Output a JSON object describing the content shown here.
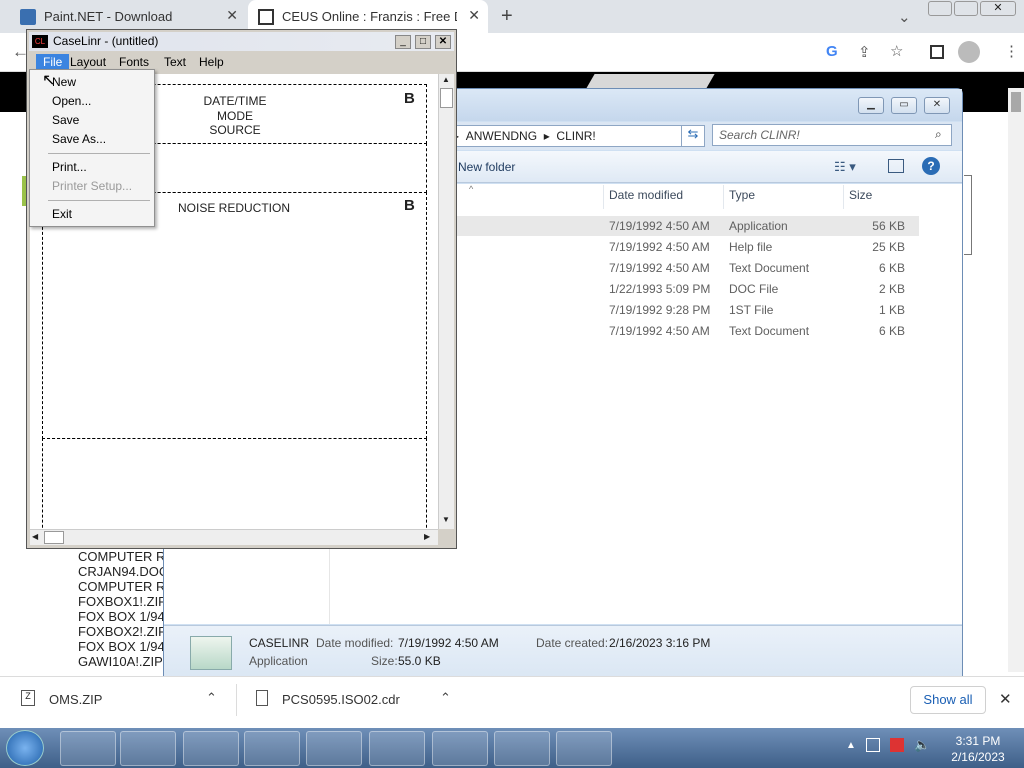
{
  "browser": {
    "tabs": [
      {
        "title": "Paint.NET - Download"
      },
      {
        "title": "CEUS Online : Franzis : Free Dow"
      }
    ],
    "new_tab": "+"
  },
  "explorer": {
    "breadcrumb": [
      "ANWENDNG",
      "CLINR!"
    ],
    "search_placeholder": "Search CLINR!",
    "toolbar_new_folder": "New folder",
    "columns": {
      "date": "Date modified",
      "type": "Type",
      "size": "Size"
    },
    "rows": [
      {
        "date": "7/19/1992 4:50 AM",
        "type": "Application",
        "size": "56 KB"
      },
      {
        "date": "7/19/1992 4:50 AM",
        "type": "Help file",
        "size": "25 KB"
      },
      {
        "date": "7/19/1992 4:50 AM",
        "type": "Text Document",
        "size": "6 KB"
      },
      {
        "date": "1/22/1993 5:09 PM",
        "type": "DOC File",
        "size": "2 KB"
      },
      {
        "date": "7/19/1992 9:28 PM",
        "type": "1ST File",
        "size": "1 KB"
      },
      {
        "date": "7/19/1992 4:50 AM",
        "type": "Text Document",
        "size": "6 KB"
      }
    ],
    "details": {
      "name": "CASELINR",
      "kind": "Application",
      "date_modified_label": "Date modified:",
      "date_modified": "7/19/1992 4:50 AM",
      "date_created_label": "Date created:",
      "date_created": "2/16/2023 3:16 PM",
      "size_label": "Size:",
      "size": "55.0 KB"
    }
  },
  "page_list": [
    "COMPUTER R",
    "CRJAN94.DOC",
    "COMPUTER R",
    "FOXBOX1!.ZIF",
    "FOX BOX 1/94",
    "FOXBOX2!.ZIF",
    "FOX BOX 1/94",
    "GAWI10A!.ZIP"
  ],
  "caselinr": {
    "title": "CaseLinr - (untitled)",
    "menus": [
      "File",
      "Layout",
      "Fonts",
      "Text",
      "Help"
    ],
    "label1": [
      "DATE/TIME",
      "MODE",
      "SOURCE"
    ],
    "label2": "NOISE REDUCTION",
    "badge": "B",
    "file_menu": {
      "new": "New",
      "open": "Open...",
      "save": "Save",
      "save_as": "Save As...",
      "print": "Print...",
      "printer_setup": "Printer Setup...",
      "exit": "Exit"
    }
  },
  "downloads": {
    "items": [
      "OMS.ZIP",
      "PCS0595.ISO02.cdr"
    ],
    "show_all": "Show all"
  },
  "taskbar": {
    "time": "3:31 PM",
    "date": "2/16/2023"
  }
}
